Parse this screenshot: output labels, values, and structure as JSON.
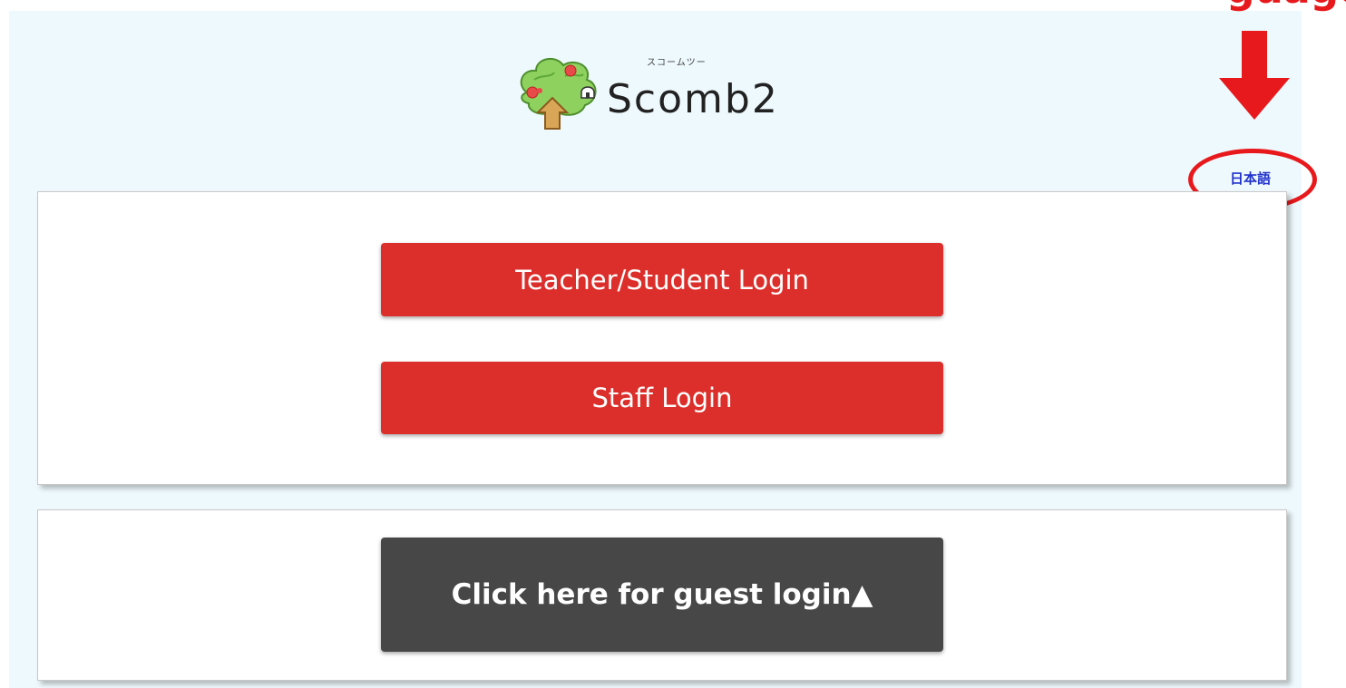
{
  "annotation": {
    "heading_fragment": "guage",
    "arrow_color": "#e8191c"
  },
  "logo": {
    "kana": "スコームツー",
    "wordmark": "Scomb2"
  },
  "language_switch": {
    "label": "日本語",
    "color": "#2233cc"
  },
  "login_panel": {
    "teacher_student_button": "Teacher/Student Login",
    "staff_button": "Staff Login",
    "button_color": "#dc2f2b"
  },
  "guest_panel": {
    "guest_button": "Click here for guest login▲",
    "button_color": "#474747"
  },
  "colors": {
    "page_background": "#eef9fd",
    "panel_background": "#ffffff"
  }
}
